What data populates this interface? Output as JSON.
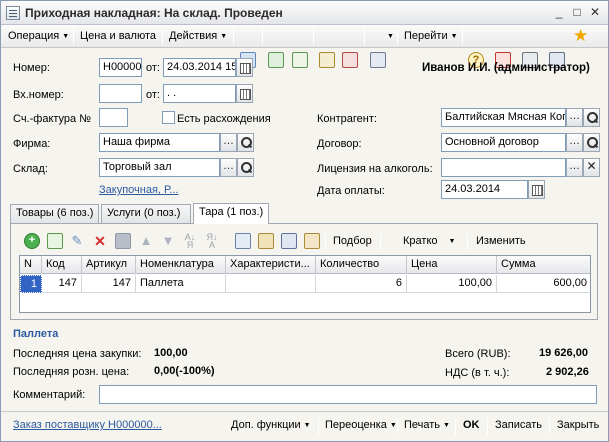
{
  "window": {
    "title": "Приходная накладная: На склад. Проведен",
    "buttons": [
      "_",
      "□",
      "✕"
    ]
  },
  "toolbar": {
    "operation": "Операция",
    "price_currency": "Цена и валюта",
    "actions": "Действия",
    "goto": "Перейти"
  },
  "header": {
    "user": "Иванов И.И. (администратор)",
    "number_label": "Номер:",
    "number_value": "Н00000",
    "from_label": "от:",
    "date_value": "24.03.2014 15",
    "in_number_label": "Вх.номер:",
    "in_number_value": "",
    "in_from_label": "от:",
    "in_date_value": " .  .",
    "invoice_label": "Сч.-фактура №",
    "invoice_value": "",
    "discrepancy_label": "Есть расхождения",
    "firm_label": "Фирма:",
    "firm_value": "Наша фирма",
    "warehouse_label": "Склад:",
    "warehouse_value": "Торговый зал",
    "purchase_link": "Закупочная, Р...",
    "contractor_label": "Контрагент:",
    "contractor_value": "Балтийская Мясная Ког",
    "contract_label": "Договор:",
    "contract_value": "Основной договор",
    "license_label": "Лицензия на алкоголь:",
    "license_value": "",
    "pay_date_label": "Дата оплаты:",
    "pay_date_value": "24.03.2014"
  },
  "tabs": [
    "Товары (6 поз.)",
    "Услуги (0 поз.)",
    "Тара (1 поз.)"
  ],
  "grid_toolbar": {
    "select": "Подбор",
    "mode": "Кратко",
    "change": "Изменить"
  },
  "table": {
    "columns": [
      "N",
      "Код",
      "Артикул",
      "Номенклатура",
      "Характеристи...",
      "Количество",
      "Цена",
      "Сумма"
    ],
    "rows": [
      [
        "1",
        "147",
        "147",
        "Паллета",
        "",
        "6",
        "100,00",
        "600,00"
      ]
    ]
  },
  "summary": {
    "item_title": "Паллета",
    "last_purchase_label": "Последняя цена закупки:",
    "last_purchase_value": "100,00",
    "last_retail_label": "Последняя розн. цена:",
    "last_retail_value": "0,00(-100%)",
    "total_label": "Всего (RUB):",
    "total_value": "19 626,00",
    "vat_label": "НДС (в т. ч.):",
    "vat_value": "2 902,26",
    "comment_label": "Комментарий:",
    "comment_value": ""
  },
  "footer": {
    "order_link": "Заказ поставщику Н000000...",
    "extra_functions": "Доп. функции",
    "revaluation": "Переоценка",
    "print": "Печать",
    "ok": "OK",
    "save": "Записать",
    "close": "Закрыть"
  },
  "colors": {
    "accent": "#2c5aa0",
    "select": "#3163c5"
  }
}
